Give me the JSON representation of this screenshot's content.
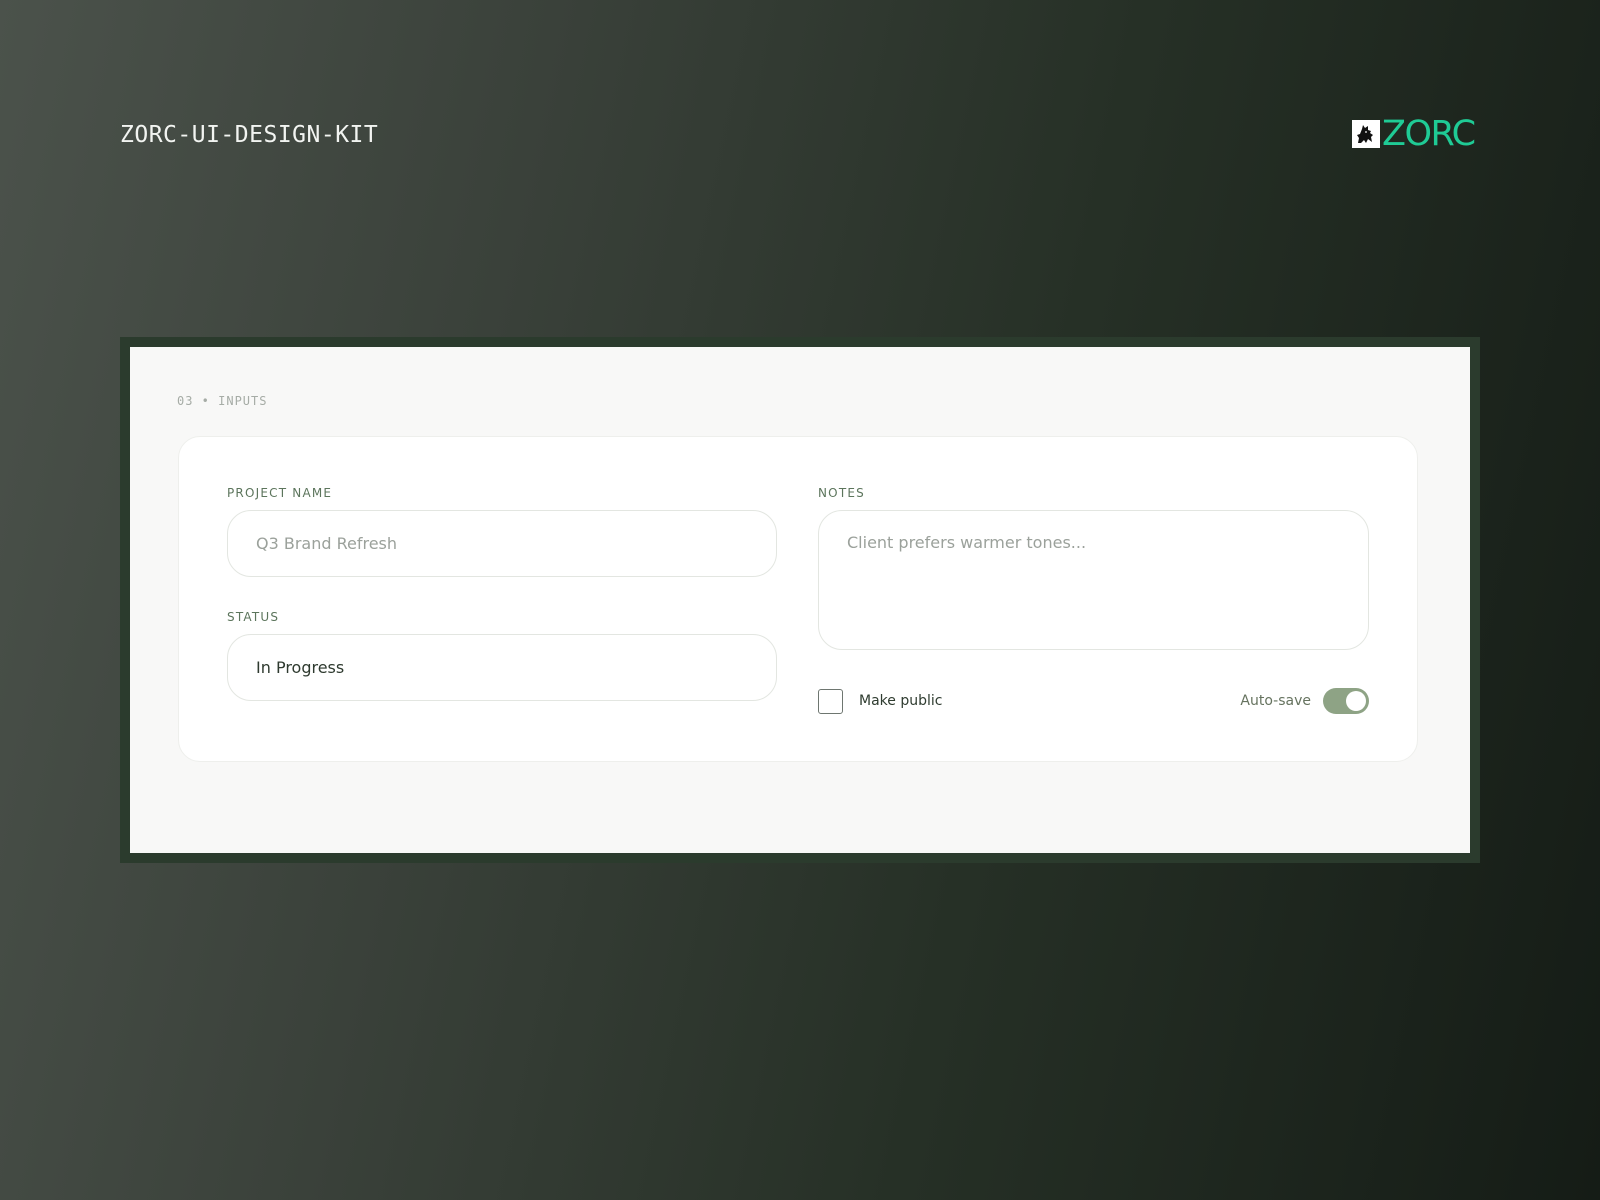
{
  "header": {
    "title": "ZORC-UI-DESIGN-KIT",
    "brand": {
      "logo_icon": "wolf-mascot-icon",
      "wordmark": "ZORC",
      "color": "#1fcb95"
    }
  },
  "section": {
    "label": "03 • INPUTS"
  },
  "form": {
    "project_name": {
      "label": "PROJECT NAME",
      "placeholder": "Q3 Brand Refresh"
    },
    "status": {
      "label": "STATUS",
      "value": "In Progress"
    },
    "notes": {
      "label": "NOTES",
      "placeholder": "Client prefers warmer tones..."
    },
    "make_public": {
      "label": "Make public",
      "checked": false
    },
    "auto_save": {
      "label": "Auto-save",
      "on": true,
      "color": "#8ea385"
    }
  }
}
